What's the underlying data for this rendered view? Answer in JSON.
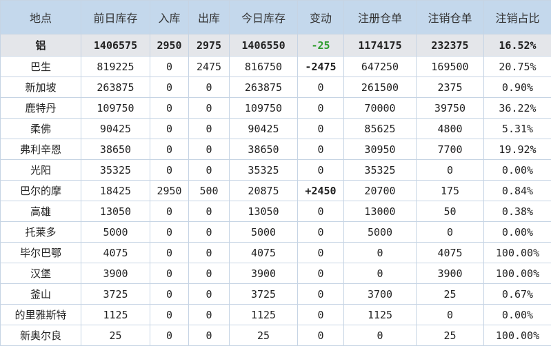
{
  "headers": [
    "地点",
    "前日库存",
    "入库",
    "出库",
    "今日库存",
    "变动",
    "注册仓单",
    "注销仓单",
    "注销占比"
  ],
  "total": [
    "铝",
    "1406575",
    "2950",
    "2975",
    "1406550",
    "-25",
    "1174175",
    "232375",
    "16.52%"
  ],
  "rows": [
    [
      "巴生",
      "819225",
      "0",
      "2475",
      "816750",
      "-2475",
      "647250",
      "169500",
      "20.75%"
    ],
    [
      "新加坡",
      "263875",
      "0",
      "0",
      "263875",
      "0",
      "261500",
      "2375",
      "0.90%"
    ],
    [
      "鹿特丹",
      "109750",
      "0",
      "0",
      "109750",
      "0",
      "70000",
      "39750",
      "36.22%"
    ],
    [
      "柔佛",
      "90425",
      "0",
      "0",
      "90425",
      "0",
      "85625",
      "4800",
      "5.31%"
    ],
    [
      "弗利辛恩",
      "38650",
      "0",
      "0",
      "38650",
      "0",
      "30950",
      "7700",
      "19.92%"
    ],
    [
      "光阳",
      "35325",
      "0",
      "0",
      "35325",
      "0",
      "35325",
      "0",
      "0.00%"
    ],
    [
      "巴尔的摩",
      "18425",
      "2950",
      "500",
      "20875",
      "+2450",
      "20700",
      "175",
      "0.84%"
    ],
    [
      "高雄",
      "13050",
      "0",
      "0",
      "13050",
      "0",
      "13000",
      "50",
      "0.38%"
    ],
    [
      "托莱多",
      "5000",
      "0",
      "0",
      "5000",
      "0",
      "5000",
      "0",
      "0.00%"
    ],
    [
      "毕尔巴鄂",
      "4075",
      "0",
      "0",
      "4075",
      "0",
      "0",
      "4075",
      "100.00%"
    ],
    [
      "汉堡",
      "3900",
      "0",
      "0",
      "3900",
      "0",
      "0",
      "3900",
      "100.00%"
    ],
    [
      "釜山",
      "3725",
      "0",
      "0",
      "3725",
      "0",
      "3700",
      "25",
      "0.67%"
    ],
    [
      "的里雅斯特",
      "1125",
      "0",
      "0",
      "1125",
      "0",
      "1125",
      "0",
      "0.00%"
    ],
    [
      "新奥尔良",
      "25",
      "0",
      "0",
      "25",
      "0",
      "0",
      "25",
      "100.00%"
    ]
  ],
  "colors": {
    "header_bg": "#c4d8ec",
    "total_bg": "#e4e6ea",
    "decrease": "#2e9d2e",
    "increase": "#d23a2a"
  }
}
